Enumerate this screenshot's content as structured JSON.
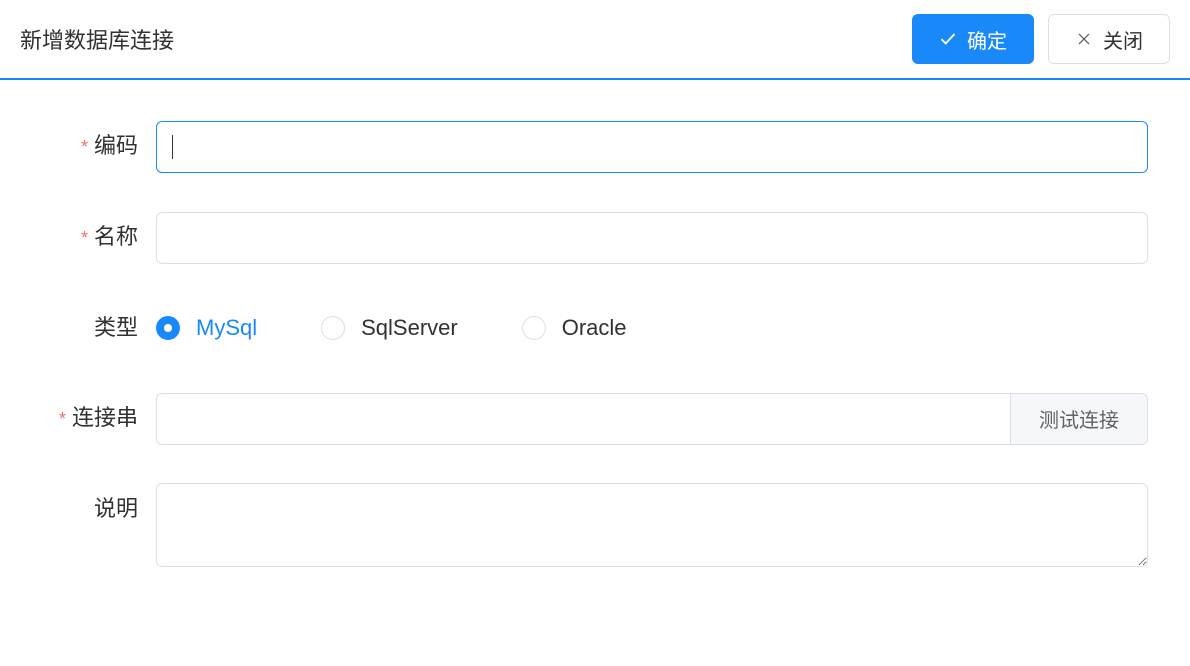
{
  "header": {
    "title": "新增数据库连接",
    "confirm_label": "确定",
    "close_label": "关闭"
  },
  "form": {
    "code": {
      "label": "编码",
      "required": true,
      "value": ""
    },
    "name": {
      "label": "名称",
      "required": true,
      "value": ""
    },
    "type": {
      "label": "类型",
      "required": false,
      "selected": "MySql",
      "options": [
        "MySql",
        "SqlServer",
        "Oracle"
      ]
    },
    "connection": {
      "label": "连接串",
      "required": true,
      "value": "",
      "test_label": "测试连接"
    },
    "description": {
      "label": "说明",
      "required": false,
      "value": ""
    }
  }
}
